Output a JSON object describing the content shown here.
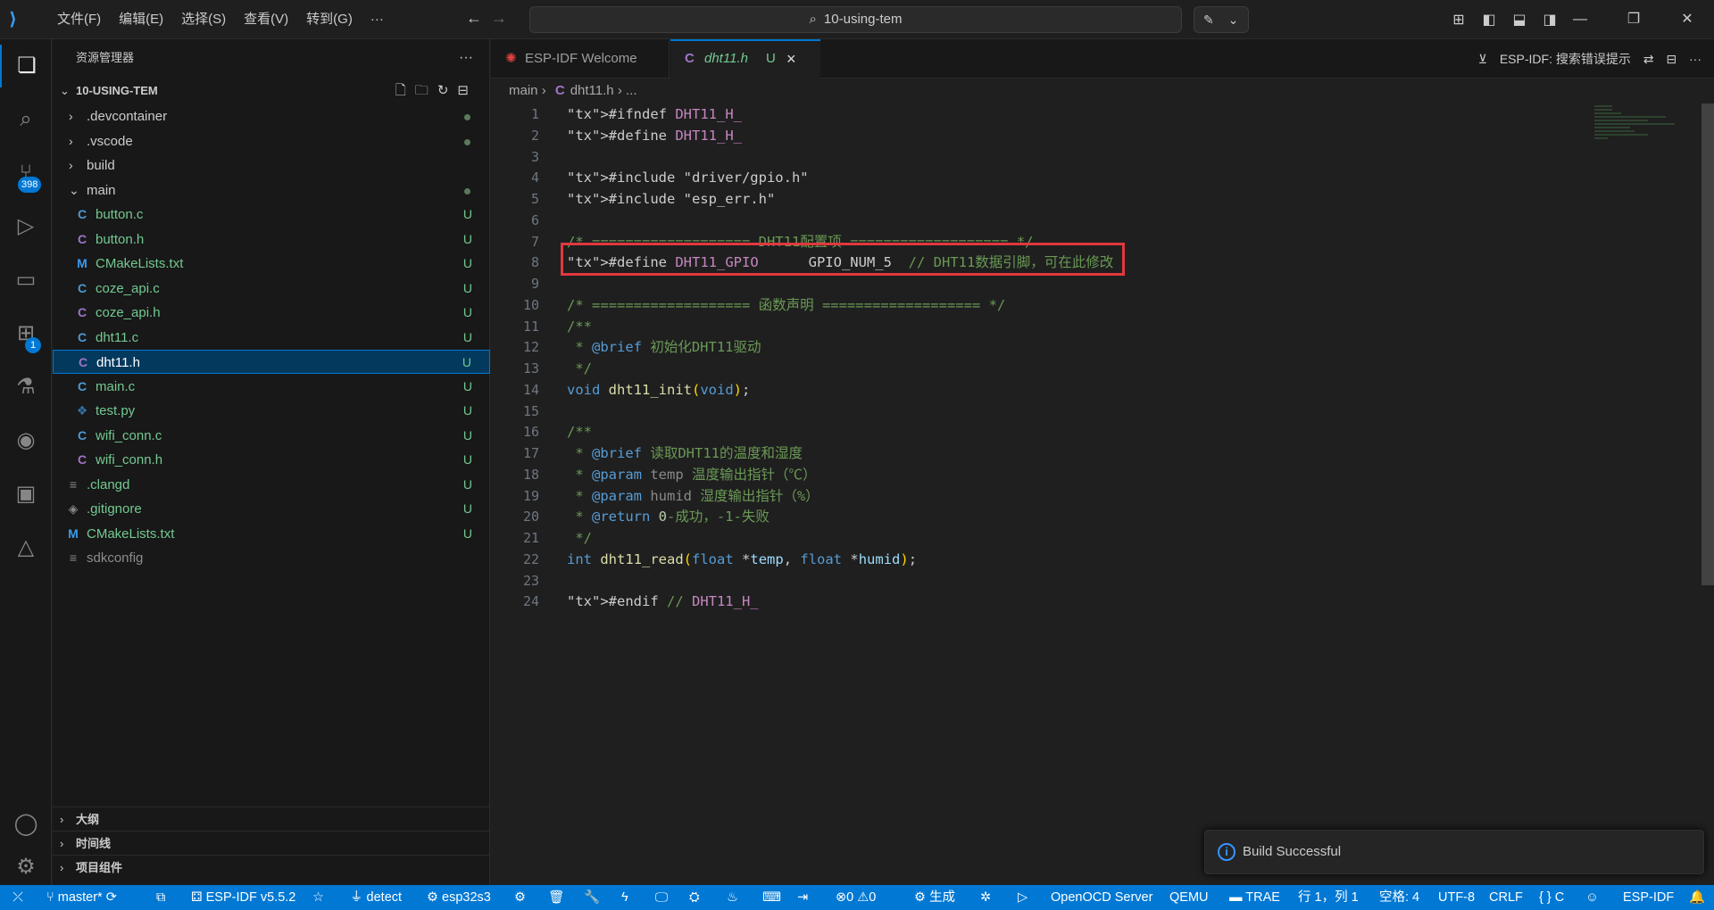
{
  "titlebar": {
    "menus": [
      "文件(F)",
      "编辑(E)",
      "选择(S)",
      "查看(V)",
      "转到(G)",
      "···"
    ],
    "search": "10-using-tem"
  },
  "activity": {
    "scm_badge": "398",
    "ext_badge": "1"
  },
  "sidebar": {
    "title": "资源管理器",
    "project": "10-USING-TEM",
    "items": [
      {
        "name": ".devcontainer",
        "kind": "folder",
        "status": "dot"
      },
      {
        "name": ".vscode",
        "kind": "folder",
        "status": "dot"
      },
      {
        "name": "build",
        "kind": "folder",
        "status": ""
      },
      {
        "name": "main",
        "kind": "folder-open",
        "status": "dot"
      },
      {
        "name": "button.c",
        "kind": "c",
        "status": "U"
      },
      {
        "name": "button.h",
        "kind": "h",
        "status": "U"
      },
      {
        "name": "CMakeLists.txt",
        "kind": "m",
        "status": "U"
      },
      {
        "name": "coze_api.c",
        "kind": "c",
        "status": "U"
      },
      {
        "name": "coze_api.h",
        "kind": "h",
        "status": "U"
      },
      {
        "name": "dht11.c",
        "kind": "c",
        "status": "U"
      },
      {
        "name": "dht11.h",
        "kind": "h",
        "status": "U"
      },
      {
        "name": "main.c",
        "kind": "c",
        "status": "U"
      },
      {
        "name": "test.py",
        "kind": "py",
        "status": "U"
      },
      {
        "name": "wifi_conn.c",
        "kind": "c",
        "status": "U"
      },
      {
        "name": "wifi_conn.h",
        "kind": "h",
        "status": "U"
      },
      {
        "name": ".clangd",
        "kind": "lines",
        "status": "U"
      },
      {
        "name": ".gitignore",
        "kind": "git",
        "status": "U"
      },
      {
        "name": "CMakeLists.txt",
        "kind": "m",
        "status": "U"
      },
      {
        "name": "sdkconfig",
        "kind": "lines",
        "status": ""
      }
    ],
    "sections": [
      "大纲",
      "时间线",
      "项目组件"
    ]
  },
  "tabs": {
    "welcome": "ESP-IDF Welcome",
    "active": "dht11.h",
    "active_status": "U",
    "tool_label": "ESP-IDF:  搜索错误提示"
  },
  "breadcrumb": {
    "folder": "main",
    "file": "dht11.h",
    "more": "..."
  },
  "editor": {
    "line_numbers": [
      "1",
      "2",
      "3",
      "4",
      "5",
      "6",
      "7",
      "8",
      "9",
      "10",
      "11",
      "12",
      "13",
      "14",
      "15",
      "16",
      "17",
      "18",
      "19",
      "20",
      "21",
      "22",
      "23",
      "24"
    ],
    "lines": [
      "#ifndef DHT11_H_",
      "#define DHT11_H_",
      "",
      "#include \"driver/gpio.h\"",
      "#include \"esp_err.h\"",
      "",
      "/* =================== DHT11配置项 =================== */",
      "#define DHT11_GPIO      GPIO_NUM_5  // DHT11数据引脚，可在此修改",
      "",
      "/* =================== 函数声明 =================== */",
      "/**",
      " * @brief 初始化DHT11驱动",
      " */",
      "void dht11_init(void);",
      "",
      "/**",
      " * @brief 读取DHT11的温度和湿度",
      " * @param temp 温度输出指针（℃）",
      " * @param humid 湿度输出指针（%）",
      " * @return 0-成功，-1-失败",
      " */",
      "int dht11_read(float *temp, float *humid);",
      "",
      "#endif // DHT11_H_"
    ]
  },
  "notification": "Build Successful",
  "statusbar": {
    "branch": "master*",
    "idf": "ESP-IDF v5.5.2",
    "port": "detect",
    "target": "esp32s3",
    "errors": "0",
    "warnings": "0",
    "build": "生成",
    "openocd": "OpenOCD Server",
    "qemu": "QEMU",
    "trae": "TRAE",
    "position": "行 1，列 1",
    "spaces": "空格: 4",
    "encoding": "UTF-8",
    "eol": "CRLF",
    "lang": "C",
    "espidf": "ESP-IDF"
  }
}
